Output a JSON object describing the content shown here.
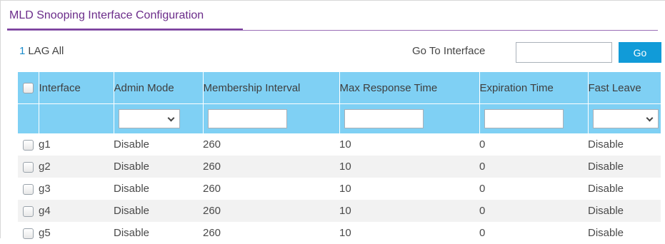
{
  "page": {
    "title": "MLD Snooping Interface Configuration"
  },
  "toolbar": {
    "lag_prefix": "1",
    "lag_text": "LAG All",
    "goto_label": "Go To Interface",
    "goto_value": "",
    "go_button": "Go"
  },
  "table": {
    "headers": [
      "Interface",
      "Admin Mode",
      "Membership Interval",
      "Max Response Time",
      "Expiration Time",
      "Fast Leave"
    ],
    "filters": {
      "admin_mode": "",
      "membership_interval": "",
      "max_response_time": "",
      "expiration_time": "",
      "fast_leave": ""
    },
    "rows": [
      {
        "interface": "g1",
        "admin_mode": "Disable",
        "membership_interval": "260",
        "max_response_time": "10",
        "expiration_time": "0",
        "fast_leave": "Disable"
      },
      {
        "interface": "g2",
        "admin_mode": "Disable",
        "membership_interval": "260",
        "max_response_time": "10",
        "expiration_time": "0",
        "fast_leave": "Disable"
      },
      {
        "interface": "g3",
        "admin_mode": "Disable",
        "membership_interval": "260",
        "max_response_time": "10",
        "expiration_time": "0",
        "fast_leave": "Disable"
      },
      {
        "interface": "g4",
        "admin_mode": "Disable",
        "membership_interval": "260",
        "max_response_time": "10",
        "expiration_time": "0",
        "fast_leave": "Disable"
      },
      {
        "interface": "g5",
        "admin_mode": "Disable",
        "membership_interval": "260",
        "max_response_time": "10",
        "expiration_time": "0",
        "fast_leave": "Disable"
      }
    ]
  },
  "colors": {
    "accent": "#7b3f9e",
    "header_bg": "#7fd0f4",
    "button": "#119bd8",
    "link": "#1a8ccc"
  }
}
